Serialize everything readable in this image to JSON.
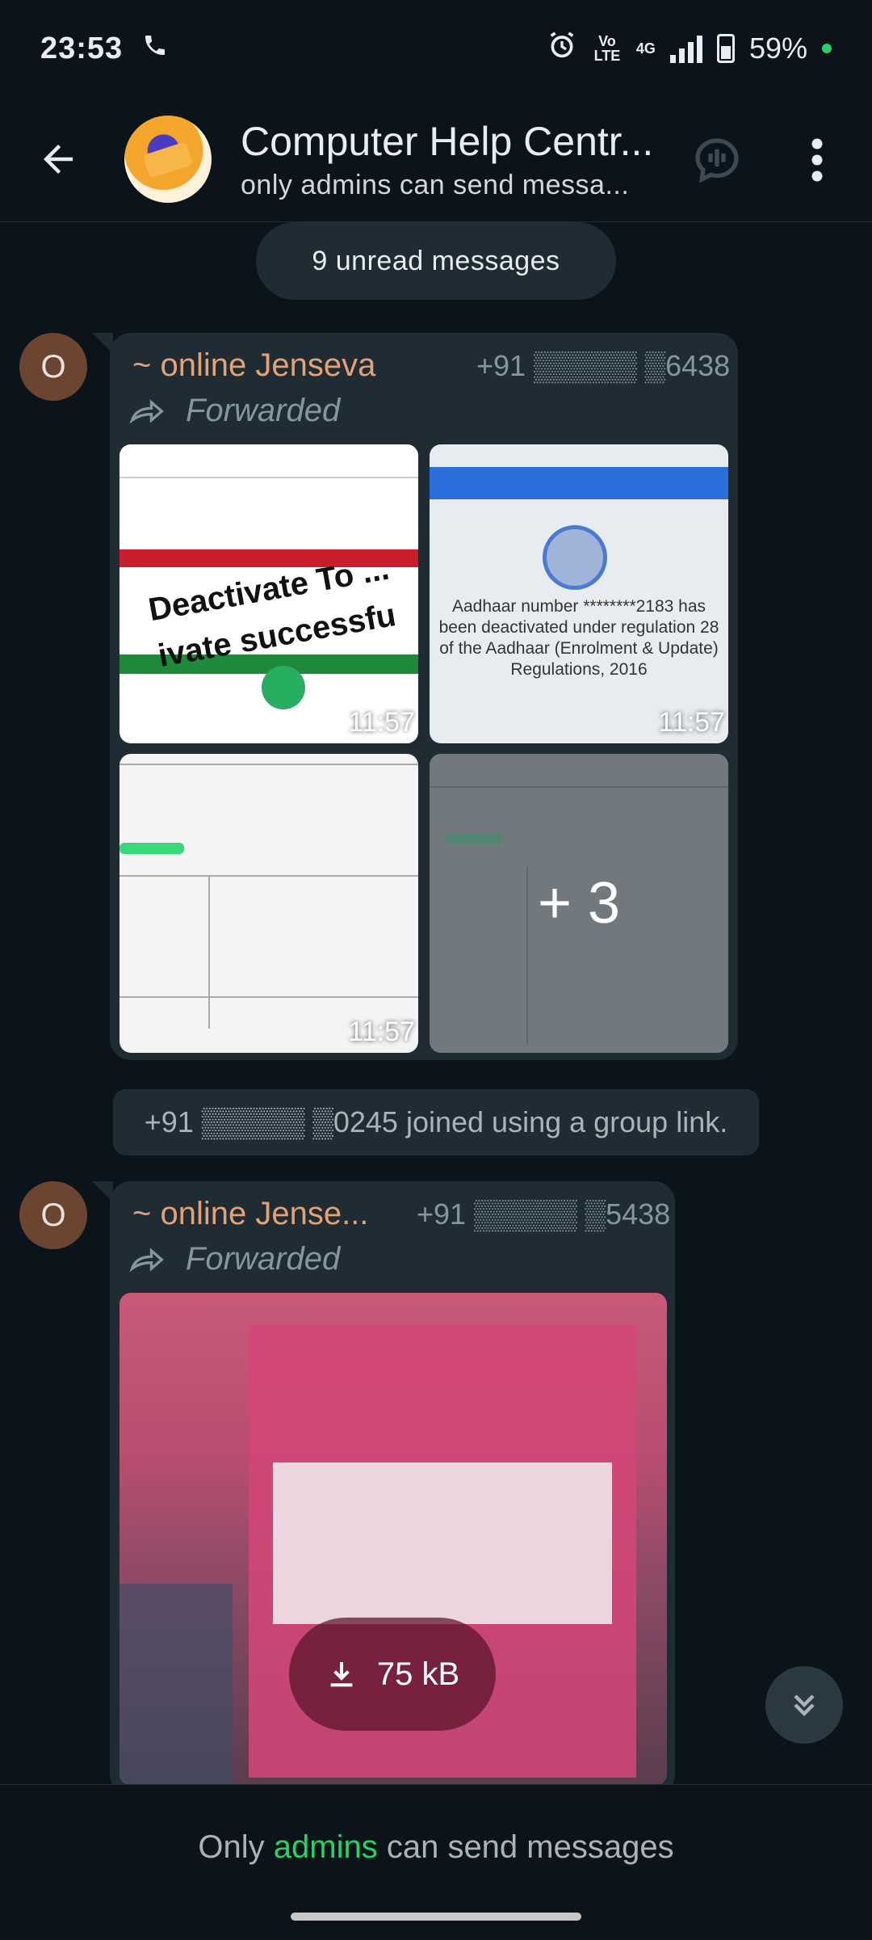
{
  "status_bar": {
    "time": "23:53",
    "volte_label": "Vo LTE",
    "network": "4G",
    "battery": "59%"
  },
  "header": {
    "title": "Computer Help Centr...",
    "subtitle": "only admins can send messa..."
  },
  "unread_banner": "9 unread messages",
  "messages": [
    {
      "avatar_letter": "O",
      "sender": "~ online Jenseva",
      "phone": "+91 ▒▒▒▒▒ ▒6438",
      "forwarded_label": "Forwarded",
      "media": [
        {
          "time": "11:57",
          "overlay": "Deactivate To ... ivate successfu"
        },
        {
          "time": "11:57",
          "overlay": "Aadhaar number ********2183 has been deactivated under regulation 28 of the Aadhaar (Enrolment & Update) Regulations, 2016"
        },
        {
          "time": "11:57"
        },
        {
          "more": "+ 3"
        }
      ]
    },
    {
      "avatar_letter": "O",
      "sender": "~ online Jense...",
      "phone": "+91 ▒▒▒▒▒ ▒5438",
      "forwarded_label": "Forwarded",
      "download_size": "75 kB"
    }
  ],
  "system_message": "+91 ▒▒▒▒▒ ▒0245 joined using a group link.",
  "footer": {
    "prefix": "Only ",
    "accent": "admins",
    "suffix": " can send messages"
  },
  "colors": {
    "background": "#0b141a",
    "bubble": "#1f2c34",
    "sender_name": "#e2a276",
    "accent_green": "#25d366"
  }
}
